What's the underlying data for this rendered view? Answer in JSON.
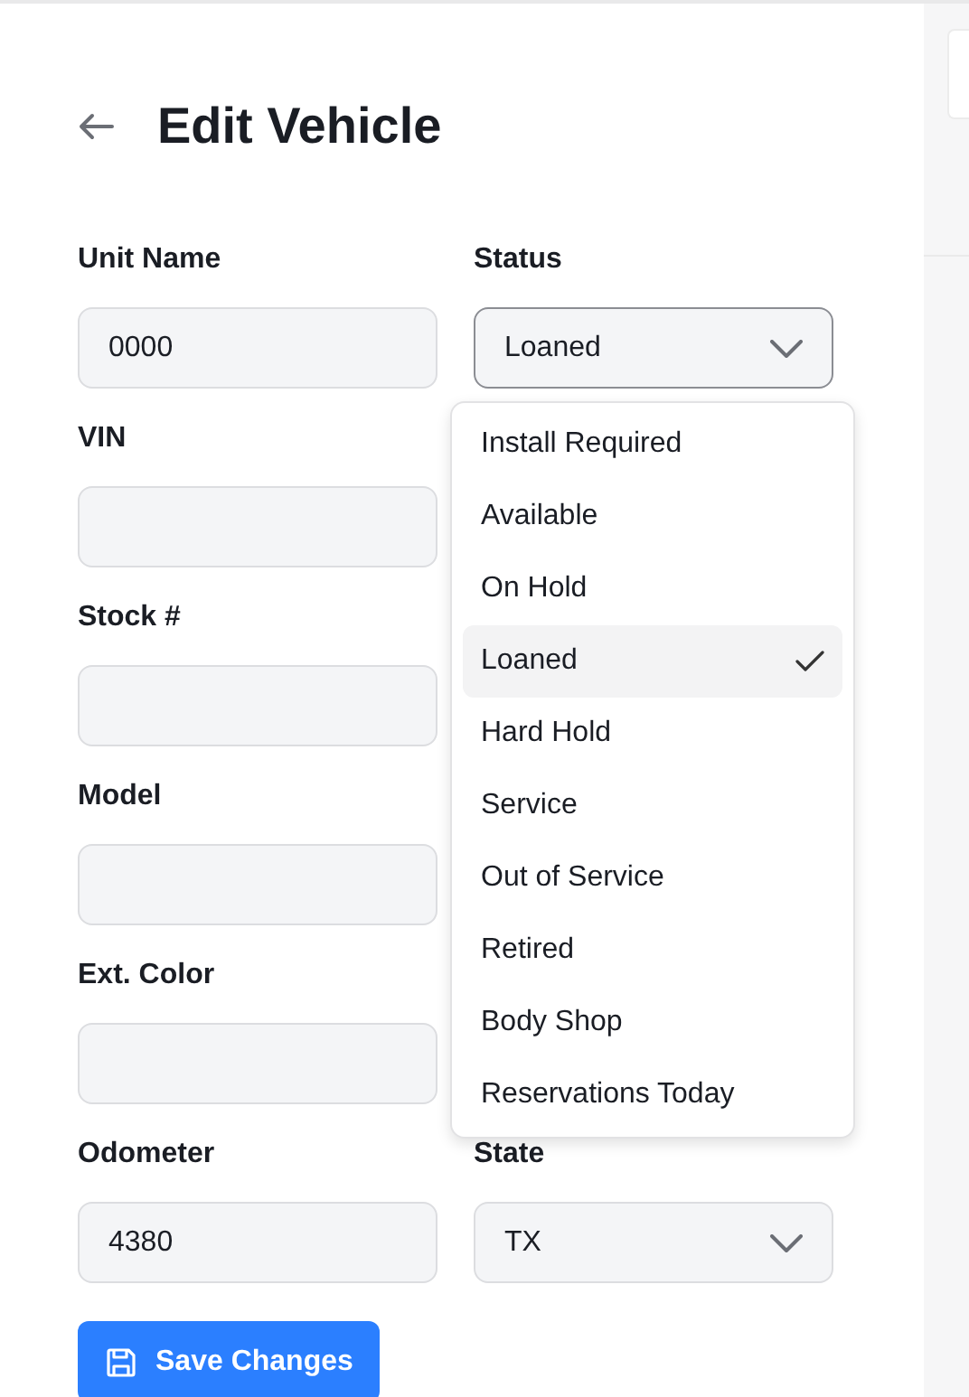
{
  "header": {
    "title": "Edit Vehicle"
  },
  "rows": [
    [
      {
        "label": "Unit Name",
        "value": "0000",
        "kind": "text"
      },
      {
        "label": "Status",
        "value": "Loaned",
        "kind": "select",
        "open": true,
        "options": [
          {
            "label": "Install Required",
            "selected": false
          },
          {
            "label": "Available",
            "selected": false
          },
          {
            "label": "On Hold",
            "selected": false
          },
          {
            "label": "Loaned",
            "selected": true
          },
          {
            "label": "Hard Hold",
            "selected": false
          },
          {
            "label": "Service",
            "selected": false
          },
          {
            "label": "Out of Service",
            "selected": false
          },
          {
            "label": "Retired",
            "selected": false
          },
          {
            "label": "Body Shop",
            "selected": false
          },
          {
            "label": "Reservations Today",
            "selected": false
          }
        ]
      }
    ],
    [
      {
        "label": "VIN",
        "kind": "text"
      }
    ],
    [
      {
        "label": "Stock #",
        "kind": "text"
      }
    ],
    [
      {
        "label": "Model",
        "kind": "text"
      }
    ],
    [
      {
        "label": "Ext. Color",
        "kind": "text"
      }
    ],
    [
      {
        "label": "Odometer",
        "value": "4380",
        "kind": "text"
      },
      {
        "label": "State",
        "value": "TX",
        "kind": "select",
        "open": false
      }
    ]
  ],
  "save_button": {
    "label": "Save Changes"
  }
}
